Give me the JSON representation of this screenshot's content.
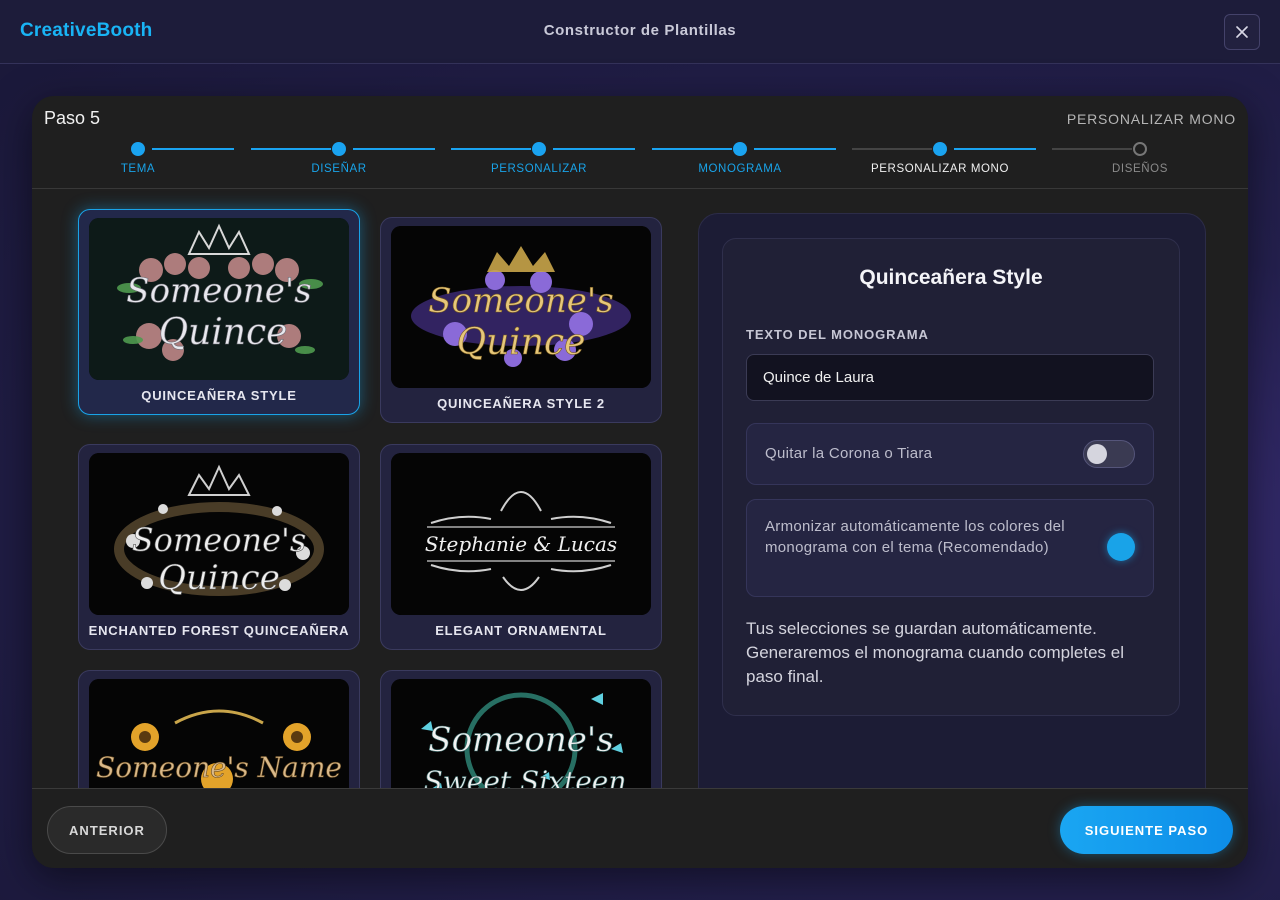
{
  "header": {
    "brand": "CreativeBooth",
    "title": "Constructor de Plantillas",
    "close_icon": "close-icon"
  },
  "modal": {
    "step_label": "Paso 5",
    "step_name": "PERSONALIZAR MONO",
    "steps": [
      {
        "label": "TEMA",
        "status": "done"
      },
      {
        "label": "DISEÑAR",
        "status": "done"
      },
      {
        "label": "PERSONALIZAR",
        "status": "done"
      },
      {
        "label": "MONOGRAMA",
        "status": "done"
      },
      {
        "label": "PERSONALIZAR MONO",
        "status": "current"
      },
      {
        "label": "DISEÑOS",
        "status": "pending"
      }
    ]
  },
  "templates": [
    {
      "title": "QUINCEAÑERA STYLE",
      "line1": "Someone's",
      "line2": "Quince",
      "selected": true
    },
    {
      "title": "QUINCEAÑERA STYLE 2",
      "line1": "Someone's",
      "line2": "Quince",
      "selected": false
    },
    {
      "title": "ENCHANTED FOREST QUINCEAÑERA",
      "line1": "Someone's",
      "line2": "Quince",
      "selected": false
    },
    {
      "title": "ELEGANT ORNAMENTAL",
      "line1": "Stephanie & Lucas",
      "line2": "",
      "selected": false
    },
    {
      "title": "",
      "line1": "Someone's Name",
      "line2": "",
      "selected": false
    },
    {
      "title": "",
      "line1": "Someone's",
      "line2": "Sweet Sixteen",
      "selected": false
    }
  ],
  "panel": {
    "title": "Quinceañera Style",
    "field_label": "TEXTO DEL MONOGRAMA",
    "field_value": "Quince de Laura",
    "option_crown": {
      "label": "Quitar la Corona o Tiara",
      "on": false
    },
    "option_harmonize": {
      "label": "Armonizar automáticamente los colores del monograma con el tema (Recomendado)",
      "on": true
    },
    "note": "Tus selecciones se guardan automáticamente. Generaremos el monograma cuando completes el paso final."
  },
  "footer": {
    "prev_label": "ANTERIOR",
    "next_label": "SIGUIENTE PASO"
  },
  "colors": {
    "accent": "#19a3e8",
    "brand": "#19b4f5",
    "modal_bg": "#1f1f1f"
  }
}
